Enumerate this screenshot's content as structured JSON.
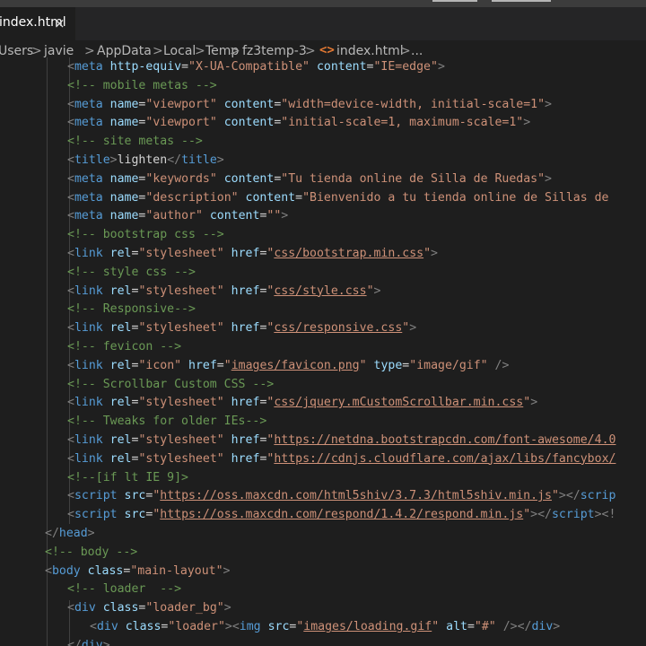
{
  "tab": {
    "label": "index.html",
    "close": "×"
  },
  "breadcrumb": {
    "items": [
      "Users",
      "javie",
      "AppData",
      "Local",
      "Temp",
      "fz3temp-3",
      "index.html",
      "..."
    ],
    "separator": ">",
    "file_icon": "html-file-icon"
  },
  "code": {
    "lines": [
      [
        [
          "p",
          "<"
        ],
        [
          "t",
          "meta "
        ],
        [
          "a",
          "http-equiv"
        ],
        [
          "x",
          "="
        ],
        [
          "s",
          "\"X-UA-Compatible\""
        ],
        [
          "x",
          " "
        ],
        [
          "a",
          "content"
        ],
        [
          "x",
          "="
        ],
        [
          "s",
          "\"IE=edge\""
        ],
        [
          "p",
          ">"
        ]
      ],
      [
        [
          "c",
          "<!-- mobile metas -->"
        ]
      ],
      [
        [
          "p",
          "<"
        ],
        [
          "t",
          "meta "
        ],
        [
          "a",
          "name"
        ],
        [
          "x",
          "="
        ],
        [
          "s",
          "\"viewport\""
        ],
        [
          "x",
          " "
        ],
        [
          "a",
          "content"
        ],
        [
          "x",
          "="
        ],
        [
          "s",
          "\"width=device-width, initial-scale=1\""
        ],
        [
          "p",
          ">"
        ]
      ],
      [
        [
          "p",
          "<"
        ],
        [
          "t",
          "meta "
        ],
        [
          "a",
          "name"
        ],
        [
          "x",
          "="
        ],
        [
          "s",
          "\"viewport\""
        ],
        [
          "x",
          " "
        ],
        [
          "a",
          "content"
        ],
        [
          "x",
          "="
        ],
        [
          "s",
          "\"initial-scale=1, maximum-scale=1\""
        ],
        [
          "p",
          ">"
        ]
      ],
      [
        [
          "c",
          "<!-- site metas -->"
        ]
      ],
      [
        [
          "p",
          "<"
        ],
        [
          "t",
          "title"
        ],
        [
          "p",
          ">"
        ],
        [
          "x",
          "lighten"
        ],
        [
          "p",
          "</"
        ],
        [
          "t",
          "title"
        ],
        [
          "p",
          ">"
        ]
      ],
      [
        [
          "p",
          "<"
        ],
        [
          "t",
          "meta "
        ],
        [
          "a",
          "name"
        ],
        [
          "x",
          "="
        ],
        [
          "s",
          "\"keywords\""
        ],
        [
          "x",
          " "
        ],
        [
          "a",
          "content"
        ],
        [
          "x",
          "="
        ],
        [
          "s",
          "\"Tu tienda online de Silla de Ruedas\""
        ],
        [
          "p",
          ">"
        ]
      ],
      [
        [
          "p",
          "<"
        ],
        [
          "t",
          "meta "
        ],
        [
          "a",
          "name"
        ],
        [
          "x",
          "="
        ],
        [
          "s",
          "\"description\""
        ],
        [
          "x",
          " "
        ],
        [
          "a",
          "content"
        ],
        [
          "x",
          "="
        ],
        [
          "s",
          "\"Bienvenido a tu tienda online de Sillas de"
        ]
      ],
      [
        [
          "p",
          "<"
        ],
        [
          "t",
          "meta "
        ],
        [
          "a",
          "name"
        ],
        [
          "x",
          "="
        ],
        [
          "s",
          "\"author\""
        ],
        [
          "x",
          " "
        ],
        [
          "a",
          "content"
        ],
        [
          "x",
          "="
        ],
        [
          "s",
          "\"\""
        ],
        [
          "p",
          ">"
        ]
      ],
      [
        [
          "c",
          "<!-- bootstrap css -->"
        ]
      ],
      [
        [
          "p",
          "<"
        ],
        [
          "t",
          "link "
        ],
        [
          "a",
          "rel"
        ],
        [
          "x",
          "="
        ],
        [
          "s",
          "\"stylesheet\""
        ],
        [
          "x",
          " "
        ],
        [
          "a",
          "href"
        ],
        [
          "x",
          "="
        ],
        [
          "s",
          "\""
        ],
        [
          "su",
          "css/bootstrap.min.css"
        ],
        [
          "s",
          "\""
        ],
        [
          "p",
          ">"
        ]
      ],
      [
        [
          "c",
          "<!-- style css -->"
        ]
      ],
      [
        [
          "p",
          "<"
        ],
        [
          "t",
          "link "
        ],
        [
          "a",
          "rel"
        ],
        [
          "x",
          "="
        ],
        [
          "s",
          "\"stylesheet\""
        ],
        [
          "x",
          " "
        ],
        [
          "a",
          "href"
        ],
        [
          "x",
          "="
        ],
        [
          "s",
          "\""
        ],
        [
          "su",
          "css/style.css"
        ],
        [
          "s",
          "\""
        ],
        [
          "p",
          ">"
        ]
      ],
      [
        [
          "c",
          "<!-- Responsive-->"
        ]
      ],
      [
        [
          "p",
          "<"
        ],
        [
          "t",
          "link "
        ],
        [
          "a",
          "rel"
        ],
        [
          "x",
          "="
        ],
        [
          "s",
          "\"stylesheet\""
        ],
        [
          "x",
          " "
        ],
        [
          "a",
          "href"
        ],
        [
          "x",
          "="
        ],
        [
          "s",
          "\""
        ],
        [
          "su",
          "css/responsive.css"
        ],
        [
          "s",
          "\""
        ],
        [
          "p",
          ">"
        ]
      ],
      [
        [
          "c",
          "<!-- fevicon -->"
        ]
      ],
      [
        [
          "p",
          "<"
        ],
        [
          "t",
          "link "
        ],
        [
          "a",
          "rel"
        ],
        [
          "x",
          "="
        ],
        [
          "s",
          "\"icon\""
        ],
        [
          "x",
          " "
        ],
        [
          "a",
          "href"
        ],
        [
          "x",
          "="
        ],
        [
          "s",
          "\""
        ],
        [
          "su",
          "images/favicon.png"
        ],
        [
          "s",
          "\""
        ],
        [
          "x",
          " "
        ],
        [
          "a",
          "type"
        ],
        [
          "x",
          "="
        ],
        [
          "s",
          "\"image/gif\""
        ],
        [
          "x",
          " "
        ],
        [
          "p",
          "/>"
        ]
      ],
      [
        [
          "c",
          "<!-- Scrollbar Custom CSS -->"
        ]
      ],
      [
        [
          "p",
          "<"
        ],
        [
          "t",
          "link "
        ],
        [
          "a",
          "rel"
        ],
        [
          "x",
          "="
        ],
        [
          "s",
          "\"stylesheet\""
        ],
        [
          "x",
          " "
        ],
        [
          "a",
          "href"
        ],
        [
          "x",
          "="
        ],
        [
          "s",
          "\""
        ],
        [
          "su",
          "css/jquery.mCustomScrollbar.min.css"
        ],
        [
          "s",
          "\""
        ],
        [
          "p",
          ">"
        ]
      ],
      [
        [
          "c",
          "<!-- Tweaks for older IEs-->"
        ]
      ],
      [
        [
          "p",
          "<"
        ],
        [
          "t",
          "link "
        ],
        [
          "a",
          "rel"
        ],
        [
          "x",
          "="
        ],
        [
          "s",
          "\"stylesheet\""
        ],
        [
          "x",
          " "
        ],
        [
          "a",
          "href"
        ],
        [
          "x",
          "="
        ],
        [
          "s",
          "\""
        ],
        [
          "su",
          "https://netdna.bootstrapcdn.com/font-awesome/4.0"
        ]
      ],
      [
        [
          "p",
          "<"
        ],
        [
          "t",
          "link "
        ],
        [
          "a",
          "rel"
        ],
        [
          "x",
          "="
        ],
        [
          "s",
          "\"stylesheet\""
        ],
        [
          "x",
          " "
        ],
        [
          "a",
          "href"
        ],
        [
          "x",
          "="
        ],
        [
          "s",
          "\""
        ],
        [
          "su",
          "https://cdnjs.cloudflare.com/ajax/libs/fancybox/"
        ]
      ],
      [
        [
          "c",
          "<!--[if lt IE 9]>"
        ]
      ],
      [
        [
          "p",
          "<"
        ],
        [
          "t",
          "script "
        ],
        [
          "a",
          "src"
        ],
        [
          "x",
          "="
        ],
        [
          "s",
          "\""
        ],
        [
          "su",
          "https://oss.maxcdn.com/html5shiv/3.7.3/html5shiv.min.js"
        ],
        [
          "s",
          "\""
        ],
        [
          "p",
          "></"
        ],
        [
          "t",
          "scrip"
        ]
      ],
      [
        [
          "p",
          "<"
        ],
        [
          "t",
          "script "
        ],
        [
          "a",
          "src"
        ],
        [
          "x",
          "="
        ],
        [
          "s",
          "\""
        ],
        [
          "su",
          "https://oss.maxcdn.com/respond/1.4.2/respond.min.js"
        ],
        [
          "s",
          "\""
        ],
        [
          "p",
          "></"
        ],
        [
          "t",
          "script"
        ],
        [
          "p",
          "><!"
        ]
      ],
      [
        [
          "p",
          "</"
        ],
        [
          "t",
          "head"
        ],
        [
          "p",
          ">"
        ]
      ],
      [
        [
          "c",
          "<!-- body -->"
        ]
      ],
      [
        [
          "p",
          "<"
        ],
        [
          "t",
          "body "
        ],
        [
          "a",
          "class"
        ],
        [
          "x",
          "="
        ],
        [
          "s",
          "\"main-layout\""
        ],
        [
          "p",
          ">"
        ]
      ],
      [
        [
          "c",
          "<!-- loader  -->"
        ]
      ],
      [
        [
          "p",
          "<"
        ],
        [
          "t",
          "div "
        ],
        [
          "a",
          "class"
        ],
        [
          "x",
          "="
        ],
        [
          "s",
          "\"loader_bg\""
        ],
        [
          "p",
          ">"
        ]
      ],
      [
        [
          "p",
          "<"
        ],
        [
          "t",
          "div "
        ],
        [
          "a",
          "class"
        ],
        [
          "x",
          "="
        ],
        [
          "s",
          "\"loader\""
        ],
        [
          "p",
          "><"
        ],
        [
          "t",
          "img "
        ],
        [
          "a",
          "src"
        ],
        [
          "x",
          "="
        ],
        [
          "s",
          "\""
        ],
        [
          "su",
          "images/loading.gif"
        ],
        [
          "s",
          "\""
        ],
        [
          "x",
          " "
        ],
        [
          "a",
          "alt"
        ],
        [
          "x",
          "="
        ],
        [
          "s",
          "\"#\""
        ],
        [
          "x",
          " "
        ],
        [
          "p",
          "/></"
        ],
        [
          "t",
          "div"
        ],
        [
          "p",
          ">"
        ]
      ],
      [
        [
          "p",
          "</"
        ],
        [
          "t",
          "div"
        ],
        [
          "p",
          ">"
        ]
      ]
    ]
  },
  "colors": {
    "tag": "#569cd6",
    "attr": "#9cdcfe",
    "string": "#ce9178",
    "comment": "#6a9955",
    "punct": "#808080",
    "text": "#d4d4d4",
    "background": "#1e1e1e"
  }
}
